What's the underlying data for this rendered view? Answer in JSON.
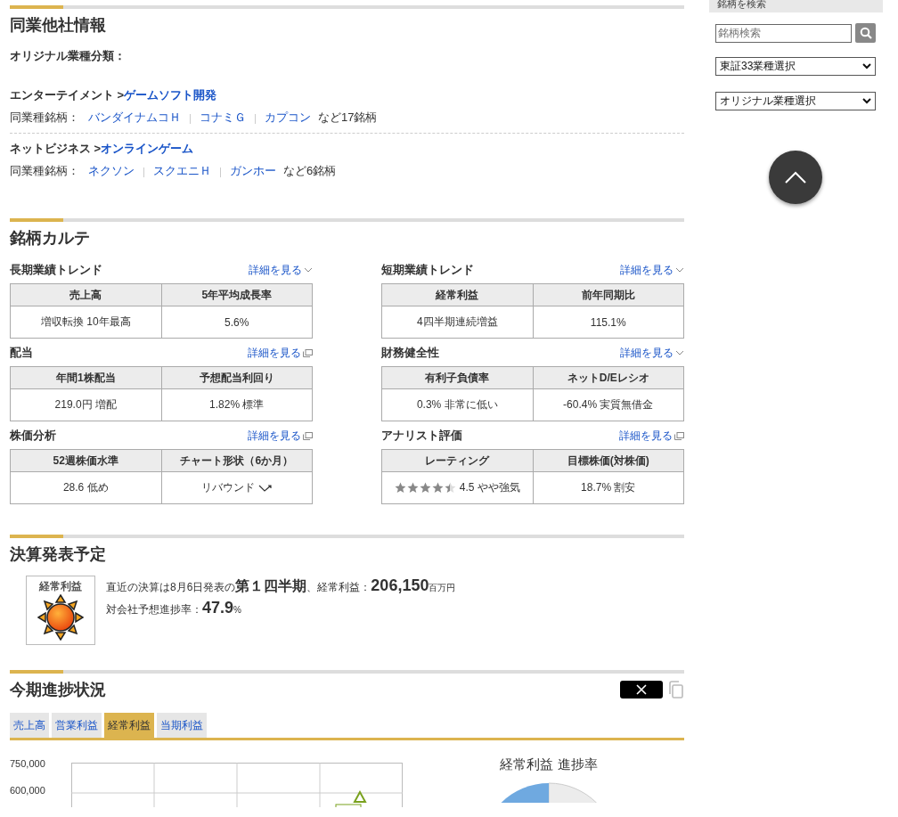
{
  "peers": {
    "title": "同業他社情報",
    "classification_label": "オリジナル業種分類：",
    "groups": [
      {
        "sector": "エンターテイメント >",
        "industry": "ゲームソフト開発",
        "peers_label": "同業種銘柄：",
        "peers": [
          "バンダイナムコＨ",
          "コナミＧ",
          "カプコン"
        ],
        "more": "など17銘柄"
      },
      {
        "sector": "ネットビジネス >",
        "industry": "オンラインゲーム",
        "peers_label": "同業種銘柄：",
        "peers": [
          "ネクソン",
          "スクエニＨ",
          "ガンホー"
        ],
        "more": "など6銘柄"
      }
    ]
  },
  "karte": {
    "title": "銘柄カルテ",
    "cards": [
      {
        "title": "長期業績トレンド",
        "link": {
          "label": "詳細を見る",
          "kind": "expand"
        },
        "columns": [
          "売上高",
          "5年平均成長率"
        ],
        "cells": [
          {
            "kind": "text",
            "text": "増収転換 10年最高"
          },
          {
            "kind": "text",
            "text": "5.6%"
          }
        ]
      },
      {
        "title": "短期業績トレンド",
        "link": {
          "label": "詳細を見る",
          "kind": "expand"
        },
        "columns": [
          "経常利益",
          "前年同期比"
        ],
        "cells": [
          {
            "kind": "text",
            "text": "4四半期連続増益"
          },
          {
            "kind": "text",
            "text": "115.1%"
          }
        ]
      },
      {
        "title": "配当",
        "link": {
          "label": "詳細を見る",
          "kind": "popup"
        },
        "columns": [
          "年間1株配当",
          "予想配当利回り"
        ],
        "cells": [
          {
            "kind": "text",
            "text": "219.0円 増配"
          },
          {
            "kind": "text",
            "text": "1.82% 標準"
          }
        ]
      },
      {
        "title": "財務健全性",
        "link": {
          "label": "詳細を見る",
          "kind": "expand"
        },
        "columns": [
          "有利子負債率",
          "ネットD/Eレシオ"
        ],
        "cells": [
          {
            "kind": "text",
            "text": "0.3% 非常に低い"
          },
          {
            "kind": "text",
            "text": "-60.4% 実質無借金"
          }
        ]
      },
      {
        "title": "株価分析",
        "link": {
          "label": "詳細を見る",
          "kind": "popup"
        },
        "columns": [
          "52週株価水準",
          "チャート形状（6か月）"
        ],
        "cells": [
          {
            "kind": "text",
            "text": "28.6 低め"
          },
          {
            "kind": "trend",
            "text": "リバウンド"
          }
        ]
      },
      {
        "title": "アナリスト評価",
        "link": {
          "label": "詳細を見る",
          "kind": "popup"
        },
        "columns": [
          "レーティング",
          "目標株価(対株価)"
        ],
        "cells": [
          {
            "kind": "rating",
            "stars": 4.5,
            "text": "4.5 やや強気"
          },
          {
            "kind": "text",
            "text": "18.7% 割安"
          }
        ]
      }
    ]
  },
  "schedule": {
    "title": "決算発表予定",
    "badge_label": "経常利益",
    "lines": [
      [
        {
          "kind": "normal",
          "text": "直近の決算は8月6日発表の"
        },
        {
          "kind": "emph",
          "text": "第１四半期"
        },
        {
          "kind": "normal",
          "text": "、経常利益："
        },
        {
          "kind": "big",
          "text": "206,150"
        },
        {
          "kind": "small",
          "text": "百万円"
        }
      ],
      [
        {
          "kind": "normal",
          "text": "対会社予想進捗率："
        },
        {
          "kind": "big",
          "text": "47.9"
        },
        {
          "kind": "small",
          "text": "%"
        }
      ]
    ]
  },
  "progress": {
    "title": "今期進捗状況",
    "tabs": [
      {
        "label": "売上高",
        "selected": false
      },
      {
        "label": "営業利益",
        "selected": false
      },
      {
        "label": "経常利益",
        "selected": true
      },
      {
        "label": "当期利益",
        "selected": false
      }
    ],
    "y_tick_labels": [
      "750,000",
      "600,000"
    ],
    "pie_title": "経常利益 進捗率"
  },
  "sidebar": {
    "title": "銘柄を検索",
    "search_placeholder": "銘柄検索",
    "selects": [
      "東証33業種選択",
      "オリジナル業種選択"
    ]
  }
}
